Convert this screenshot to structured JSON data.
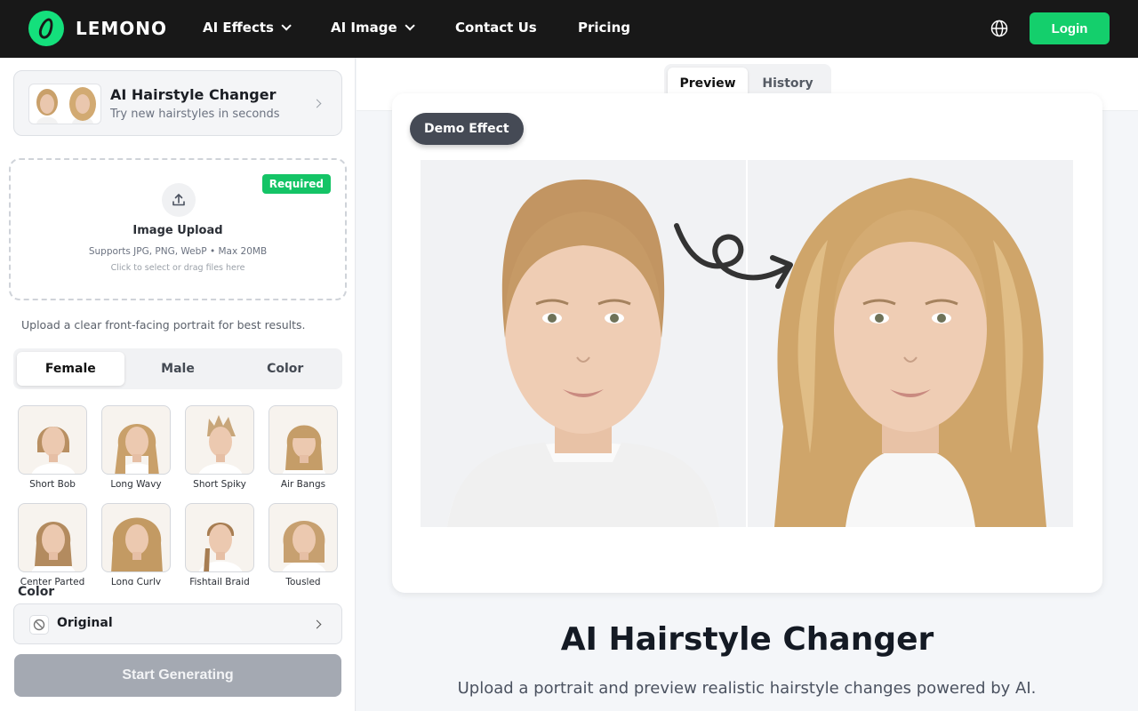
{
  "topbar": {
    "brand": "LEMONO",
    "nav": [
      {
        "label": "AI Effects",
        "dropdown": true
      },
      {
        "label": "AI Image",
        "dropdown": true
      },
      {
        "label": "Contact Us",
        "dropdown": false
      },
      {
        "label": "Pricing",
        "dropdown": false
      }
    ],
    "language_icon": "globe-icon",
    "login_label": "Login"
  },
  "tool": {
    "title": "AI Hairstyle Changer",
    "subtitle": "Try new hairstyles in seconds"
  },
  "upload": {
    "badge": "Required",
    "title": "Image Upload",
    "formats": "Supports JPG, PNG, WebP • Max 20MB",
    "hint": "Click to select or drag files here"
  },
  "tip": "Upload a clear front-facing portrait for best results.",
  "style_tabs": [
    {
      "label": "Female",
      "active": true
    },
    {
      "label": "Male",
      "active": false
    },
    {
      "label": "Color",
      "active": false
    }
  ],
  "hairstyles": [
    {
      "label": "Short Bob",
      "hair": "#b88f62"
    },
    {
      "label": "Long Wavy",
      "hair": "#c9a06a"
    },
    {
      "label": "Short Spiky",
      "hair": "#c8a67a"
    },
    {
      "label": "Air Bangs",
      "hair": "#c59d68"
    },
    {
      "label": "Center Parted",
      "hair": "#b38b5f"
    },
    {
      "label": "Long Curly",
      "hair": "#c39a63"
    },
    {
      "label": "Fishtail Braid",
      "hair": "#a77d52"
    },
    {
      "label": "Tousled",
      "hair": "#c7a070"
    }
  ],
  "color": {
    "heading": "Color",
    "value": "Original"
  },
  "generate_label": "Start Generating",
  "preview_tabs": [
    {
      "label": "Preview",
      "active": true
    },
    {
      "label": "History",
      "active": false
    }
  ],
  "demo_badge": "Demo Effect",
  "hero": {
    "title": "AI Hairstyle Changer",
    "subtitle": "Upload a portrait and preview realistic hairstyle changes powered by AI."
  },
  "colors": {
    "topbar": "#181818",
    "brand_green": "#14e07c",
    "login_green": "#14cf6c",
    "required_green": "#14c466",
    "generate_disabled": "#a4a9b2"
  }
}
